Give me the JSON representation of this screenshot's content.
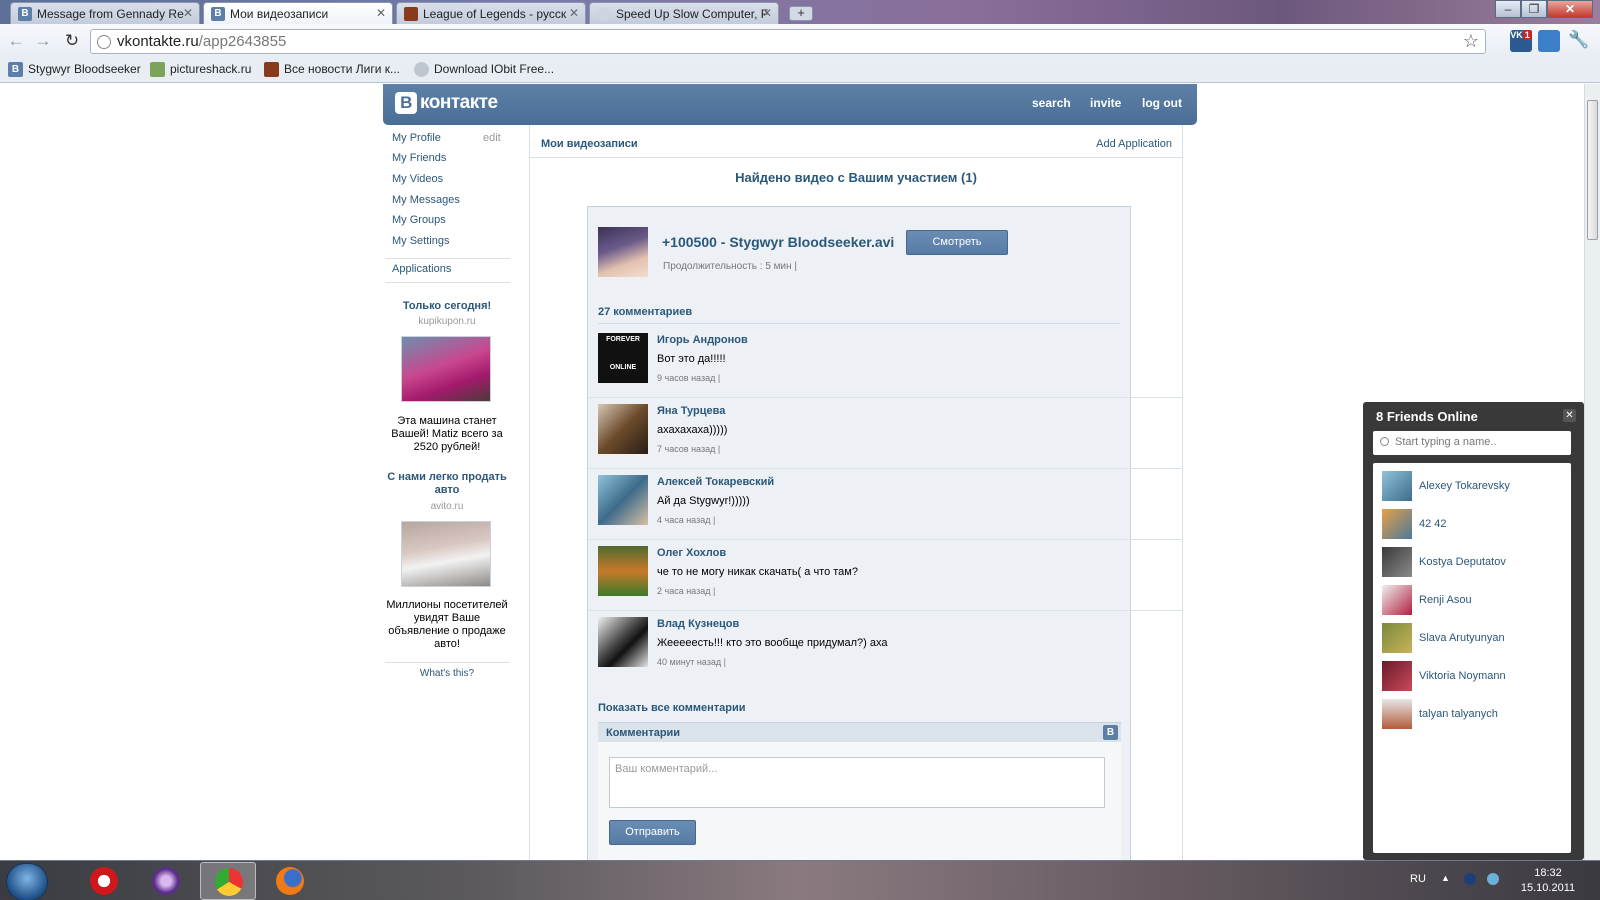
{
  "browser": {
    "tabs": [
      {
        "label": "Message from Gennady Re",
        "icon": "vk-favicon",
        "active": false
      },
      {
        "label": "Мои видеозаписи",
        "icon": "vk-favicon",
        "active": true
      },
      {
        "label": "League of Legends - русск",
        "icon": "lol-favicon",
        "active": false
      },
      {
        "label": "Speed Up Slow Computer, F",
        "icon": "iobit-favicon",
        "active": false
      }
    ],
    "url_host": "vkontakte.ru",
    "url_path": "/app2643855",
    "bookmarks": [
      {
        "label": "Stygwyr Bloodseeker",
        "icon": "vk-favicon"
      },
      {
        "label": "pictureshack.ru",
        "icon": "image-favicon"
      },
      {
        "label": "Все новости Лиги к...",
        "icon": "lol-favicon"
      },
      {
        "label": "Download IObit Free...",
        "icon": "iobit-favicon"
      }
    ],
    "ext_badge": "1"
  },
  "vk": {
    "logo_letter": "В",
    "logo_text": "контакте",
    "topnav": {
      "search": "search",
      "invite": "invite",
      "logout": "log out"
    },
    "sidebar": {
      "my_profile": "My Profile",
      "edit": "edit",
      "my_friends": "My Friends",
      "my_videos": "My Videos",
      "my_messages": "My Messages",
      "my_groups": "My Groups",
      "my_settings": "My Settings",
      "applications": "Applications",
      "whats_this": "What's this?"
    },
    "ads": [
      {
        "title": "Только сегодня!",
        "domain": "kupikupon.ru",
        "text": "Эта машина станет Вашей! Matiz всего за 2520 рублей!"
      },
      {
        "title": "С нами легко продать авто",
        "domain": "avito.ru",
        "text": "Миллионы посетителей увидят Ваше объявление о продаже авто!"
      }
    ]
  },
  "main": {
    "breadcrumb": "Мои видеозаписи",
    "add_application": "Add Application",
    "found_heading": "Найдено видео с Вашим участием (1)",
    "video": {
      "title": "+100500 - Stygwyr Bloodseeker.avi",
      "duration": "Продолжительность : 5 мин |",
      "watch_button": "Смотреть"
    },
    "comments_count": "27 комментариев",
    "comments": [
      {
        "name": "Игорь Андронов",
        "text": "Вот это да!!!!!",
        "time": "9 часов назад |",
        "avatar": "forever-online-avatar"
      },
      {
        "name": "Яна Турцева",
        "text": "ахахахаха)))))",
        "time": "7 часов назад |",
        "avatar": "user-avatar"
      },
      {
        "name": "Алексей Токаревский",
        "text": "Ай да Stygwyr!)))))",
        "time": "4 часа назад |",
        "avatar": "user-avatar"
      },
      {
        "name": "Олег Хохлов",
        "text": "че то не могу никак скачать( а что там?",
        "time": "2 часа назад |",
        "avatar": "user-avatar"
      },
      {
        "name": "Влад Кузнецов",
        "text": "Жееееесть!!! кто это вообще придумал?) аха",
        "time": "40 минут назад |",
        "avatar": "user-avatar"
      }
    ],
    "show_all": "Показать все комментарии",
    "comment_box": {
      "header": "Комментарии",
      "badge": "В",
      "placeholder": "Ваш комментарий...",
      "submit": "Отправить"
    }
  },
  "friends_online": {
    "title": "8 Friends Online",
    "search_placeholder": "Start typing a name..",
    "friends": [
      "Alexey Tokarevsky",
      "42 42",
      "Kostya Deputatov",
      "Renji Asou",
      "Slava Arutyunyan",
      "Viktoria Noymann",
      "talyan talyanych"
    ]
  },
  "taskbar": {
    "language": "RU",
    "time": "18:32",
    "date": "15.10.2011",
    "apps": [
      "opera-icon",
      "torrent-icon",
      "chrome-icon",
      "firefox-icon"
    ]
  },
  "colors": {
    "vk_blue": "#4b6f97",
    "link": "#2b587a",
    "box_bg": "#edf1f5"
  }
}
